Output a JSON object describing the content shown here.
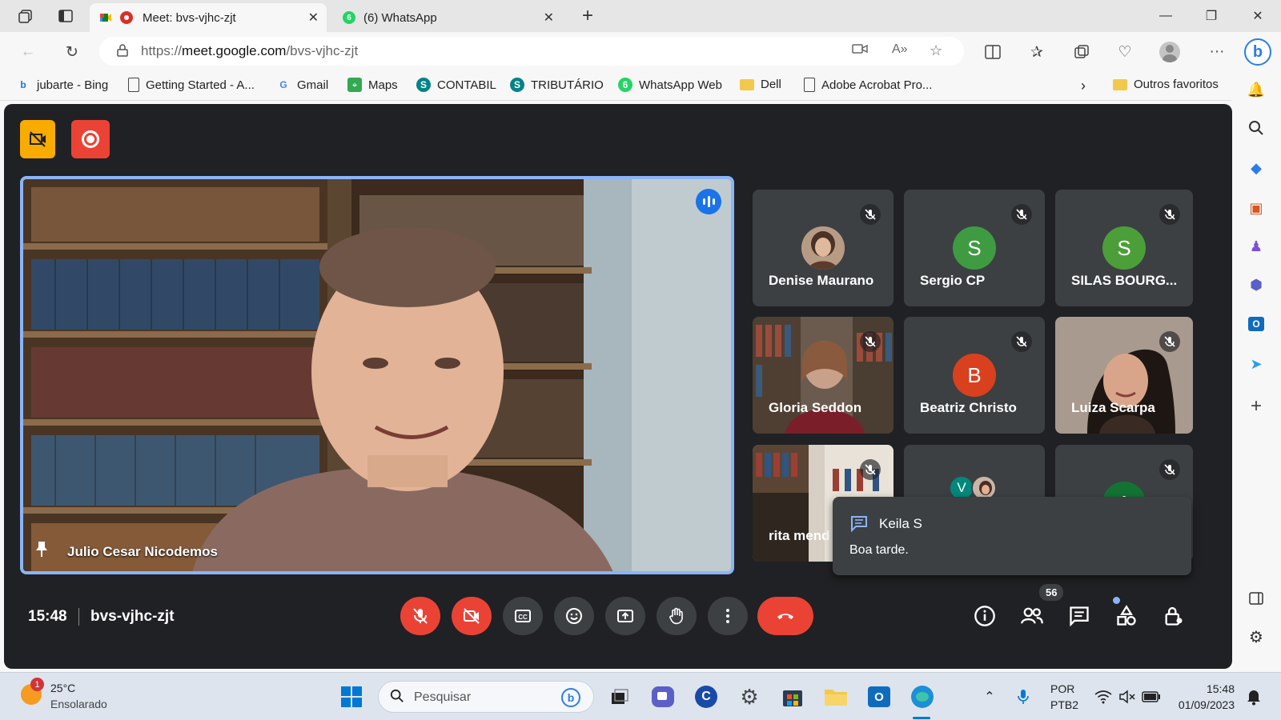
{
  "browser": {
    "tabs": [
      {
        "title": "Meet: bvs-vjhc-zjt",
        "active": true
      },
      {
        "title": "(6) WhatsApp",
        "active": false,
        "badge": "6"
      }
    ],
    "url_prefix": "https://",
    "url_domain": "meet.google.com",
    "url_path": "/bvs-vjhc-zjt",
    "bookmarks": [
      {
        "label": "jubarte - Bing",
        "icon": "bing-icon"
      },
      {
        "label": "Getting Started - A...",
        "icon": "page-icon"
      },
      {
        "label": "Gmail",
        "icon": "google-icon"
      },
      {
        "label": "Maps",
        "icon": "maps-icon"
      },
      {
        "label": "CONTABIL",
        "icon": "sharepoint-icon"
      },
      {
        "label": "TRIBUTÁRIO",
        "icon": "sharepoint-icon"
      },
      {
        "label": "WhatsApp Web",
        "icon": "whatsapp-icon",
        "badge": "6"
      },
      {
        "label": "Dell",
        "icon": "folder-icon"
      },
      {
        "label": "Adobe Acrobat Pro...",
        "icon": "page-icon"
      }
    ],
    "other_favorites": "Outros favoritos"
  },
  "meet": {
    "time": "15:48",
    "meeting_code": "bvs-vjhc-zjt",
    "main_speaker": "Julio Cesar Nicodemos",
    "participants": [
      {
        "name": "Denise Maurano",
        "type": "photo",
        "muted": true
      },
      {
        "name": "Sergio CP",
        "type": "initial",
        "initial": "S",
        "color": "#3f9b41",
        "muted": true
      },
      {
        "name": "SILAS BOURG...",
        "type": "initial",
        "initial": "S",
        "color": "#4c9f38",
        "muted": true
      },
      {
        "name": "Gloria Seddon",
        "type": "video",
        "muted": true
      },
      {
        "name": "Beatriz Christo",
        "type": "initial",
        "initial": "B",
        "color": "#d9401e",
        "muted": true
      },
      {
        "name": "Luiza Scarpa",
        "type": "video",
        "muted": true
      },
      {
        "name": "rita mend",
        "type": "video",
        "muted": true
      },
      {
        "name": "",
        "type": "group",
        "initial": "V",
        "muted": false
      },
      {
        "name": "",
        "type": "initial",
        "initial": "A",
        "color": "#137333",
        "muted": true
      }
    ],
    "toast": {
      "sender": "Keila S",
      "message": "Boa tarde."
    },
    "participant_count": "56",
    "colors": {
      "background": "#202124",
      "tile": "#3c4043",
      "danger": "#ea4335",
      "accent": "#8ab4f8"
    }
  },
  "taskbar": {
    "weather_temp": "25°C",
    "weather_desc": "Ensolarado",
    "weather_badge": "1",
    "search_placeholder": "Pesquisar",
    "lang_top": "POR",
    "lang_bottom": "PTB2",
    "time": "15:48",
    "date": "01/09/2023"
  }
}
